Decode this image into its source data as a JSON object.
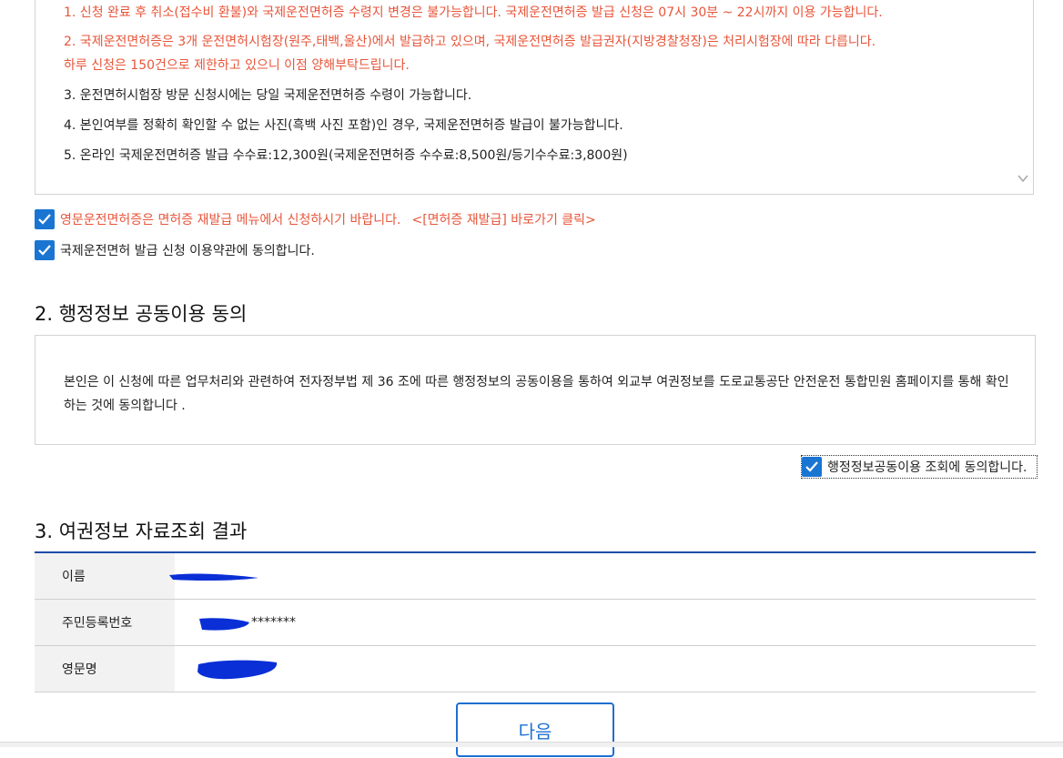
{
  "terms": {
    "line1": "1. 신청 완료 후 취소(접수비 환불)와 국제운전면허증 수령지 변경은 불가능합니다. 국제운전면허증 발급 신청은 07시 30분 ~ 22시까지 이용 가능합니다.",
    "line2a": "2. 국제운전면허증은 3개 운전면허시험장(원주,태백,울산)에서 발급하고 있으며, 국제운전면허증 발급권자(지방경찰청장)은 처리시험장에 따라 다릅니다.",
    "line2b": "하루 신청은 150건으로 제한하고 있으니 이점 양해부탁드립니다.",
    "line3": "3. 운전면허시험장 방문 신청시에는 당일 국제운전면허증 수령이 가능합니다.",
    "line4": "4. 본인여부를 정확히 확인할 수 없는 사진(흑백 사진 포함)인 경우, 국제운전면허증 발급이 불가능합니다.",
    "line5": "5. 온라인 국제운전면허증 발급 수수료:12,300원(국제운전면허증 수수료:8,500원/등기수수료:3,800원)"
  },
  "checks": {
    "english_license": "영문운전면허증은 면허증 재발급 메뉴에서 신청하시기 바랍니다.",
    "shortcut": "<[면허증 재발급] 바로가기 클릭>",
    "terms_agree": "국제운전면허 발급 신청 이용약관에 동의합니다."
  },
  "section2": {
    "title": "2. 행정정보 공동이용 동의",
    "body": "본인은 이 신청에 따른 업무처리와 관련하여 전자정부법 제 36 조에 따른 행정정보의 공동이용을 통하여 외교부 여권정보를 도로교통공단 안전운전 통합민원 홈페이지를 통해 확인하는 것에 동의합니다 .",
    "agree": "행정정보공동이용 조회에 동의합니다."
  },
  "section3": {
    "title": "3. 여권정보 자료조회 결과",
    "rows": [
      {
        "label": "이름",
        "value": ""
      },
      {
        "label": "주민등록번호",
        "value": "*******"
      },
      {
        "label": "영문명",
        "value": ""
      }
    ]
  },
  "buttons": {
    "next": "다음"
  },
  "colors": {
    "accent": "#1a75d2",
    "notice_red": "#e8553a",
    "table_border": "#1d4ea8",
    "redaction": "#0a2fd6"
  }
}
